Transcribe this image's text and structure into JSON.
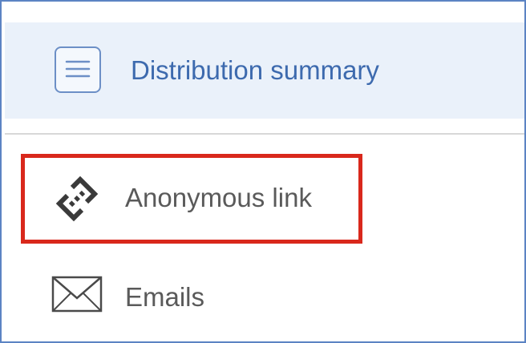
{
  "header": {
    "label": "Distribution summary",
    "icon": "menu-list-icon"
  },
  "nav": {
    "items": [
      {
        "label": "Anonymous link",
        "icon": "link-icon",
        "highlighted": true
      },
      {
        "label": "Emails",
        "icon": "envelope-icon",
        "highlighted": false
      }
    ]
  },
  "colors": {
    "accent": "#3d6aae",
    "header_bg": "#eaf1fa",
    "highlight": "#d9281c",
    "text": "#5a5a5a"
  }
}
